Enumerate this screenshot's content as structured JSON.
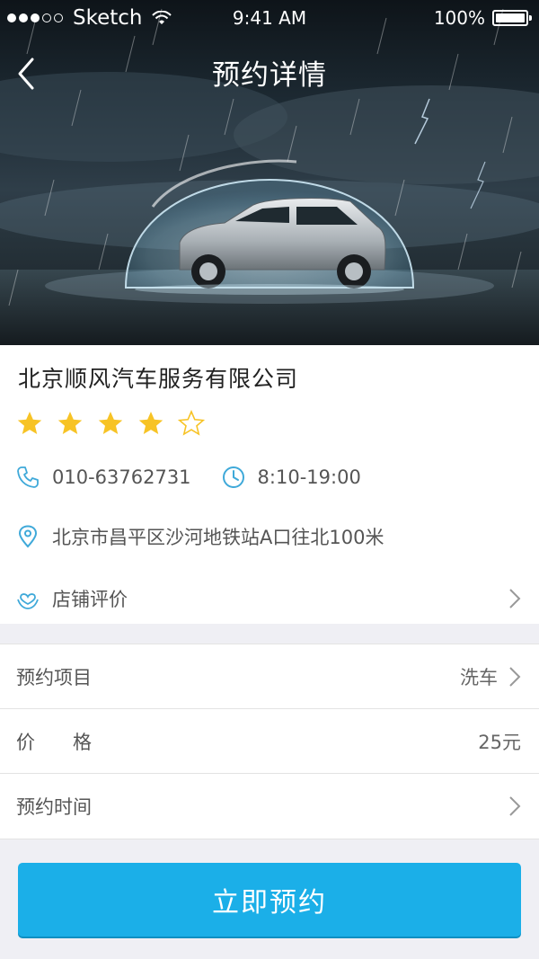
{
  "status_bar": {
    "carrier": "Sketch",
    "time": "9:41 AM",
    "battery": "100%",
    "signal_dots_filled": 3,
    "signal_dots_total": 5
  },
  "header": {
    "title": "预约详情",
    "back_icon": "chevron-left-icon"
  },
  "shop": {
    "name": "北京顺风汽车服务有限公司",
    "rating": 4,
    "rating_max": 5,
    "phone": "010-63762731",
    "hours": "8:10-19:00",
    "address": "北京市昌平区沙河地铁站A口往北100米",
    "reviews_label": "店铺评价"
  },
  "form": {
    "item_label": "预约项目",
    "item_value": "洗车",
    "price_label": "价格",
    "price_value": "25元",
    "time_label": "预约时间"
  },
  "actions": {
    "book_label": "立即预约"
  },
  "colors": {
    "accent": "#1bafe8",
    "icon_blue": "#3fa9d9",
    "star": "#f7c325",
    "background": "#efeff4"
  }
}
